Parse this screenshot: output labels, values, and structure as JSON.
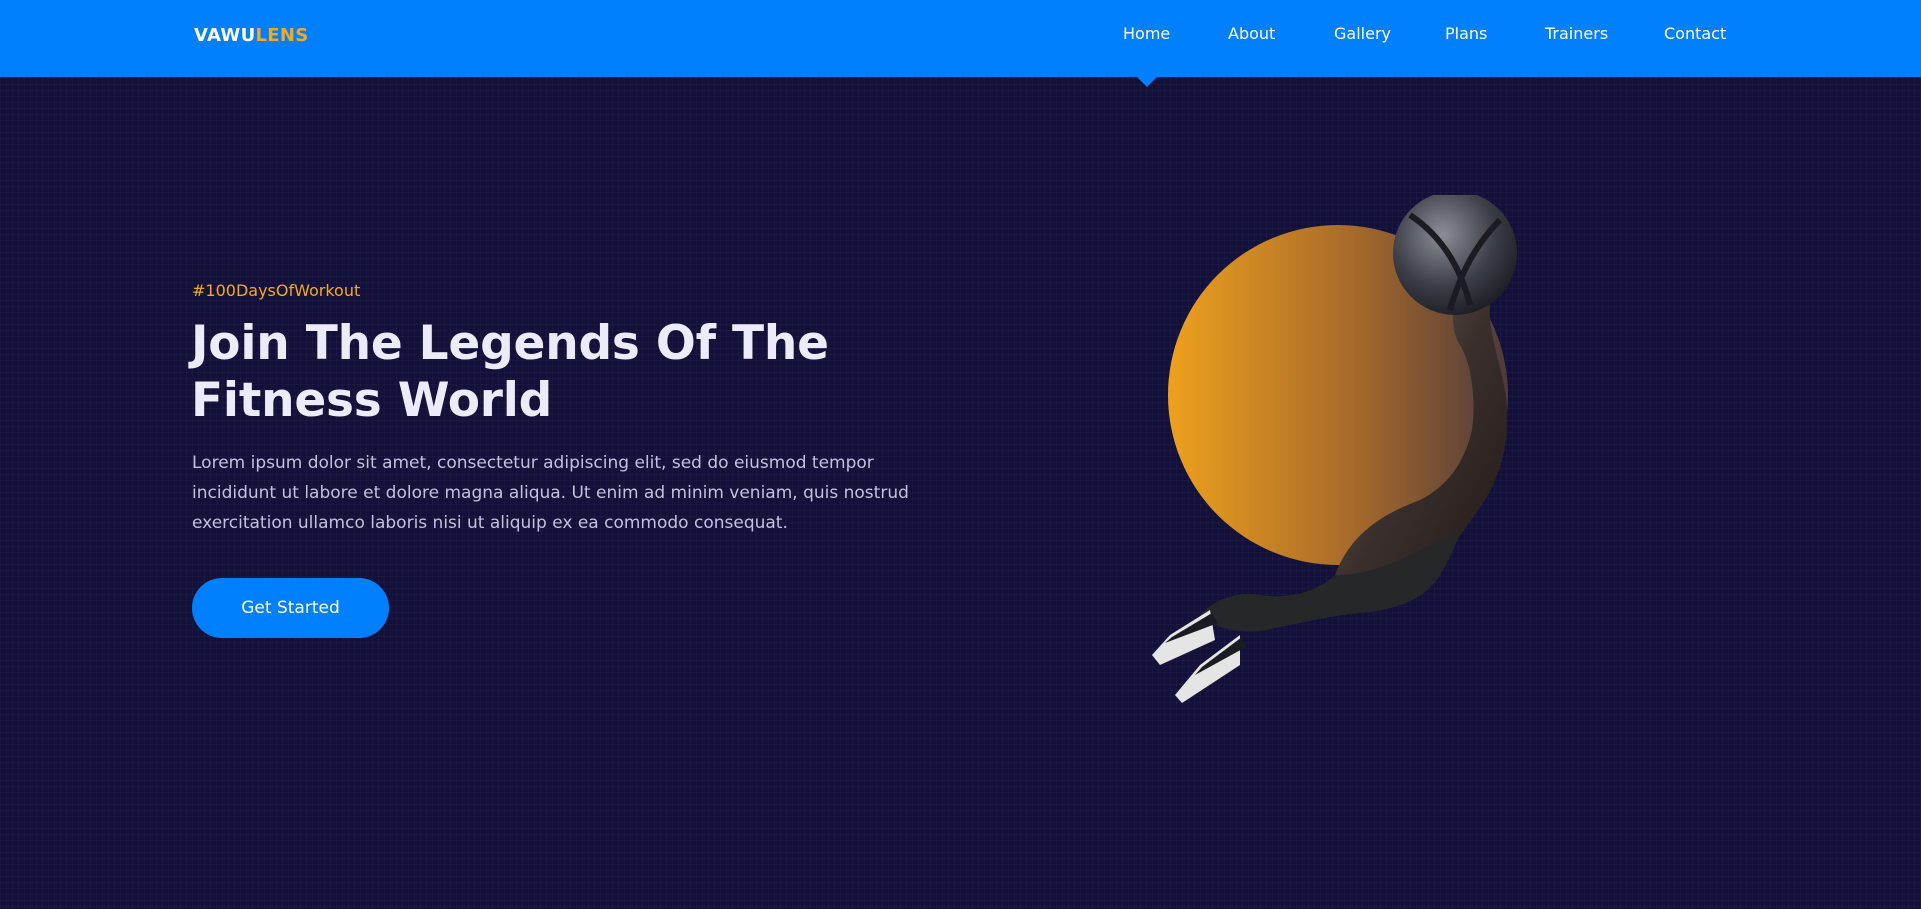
{
  "brand": {
    "part1": "VAWU",
    "part2": "LENS"
  },
  "nav": {
    "items": [
      {
        "label": "Home",
        "active": true
      },
      {
        "label": "About"
      },
      {
        "label": "Gallery"
      },
      {
        "label": "Plans"
      },
      {
        "label": "Trainers"
      },
      {
        "label": "Contact"
      }
    ]
  },
  "hero": {
    "tag": "#100DaysOfWorkout",
    "title": "Join The Legends Of The Fitness World",
    "description": "Lorem ipsum dolor sit amet, consectetur adipiscing elit, sed do eiusmod tempor incididunt ut labore et dolore magna aliqua. Ut enim ad minim veniam, quis nostrud exercitation ullamco laboris nisi ut aliquip ex ea commodo consequat.",
    "cta_label": "Get Started"
  },
  "colors": {
    "primary": "#0180fe",
    "accent": "#f6a821",
    "background": "#13113a"
  }
}
